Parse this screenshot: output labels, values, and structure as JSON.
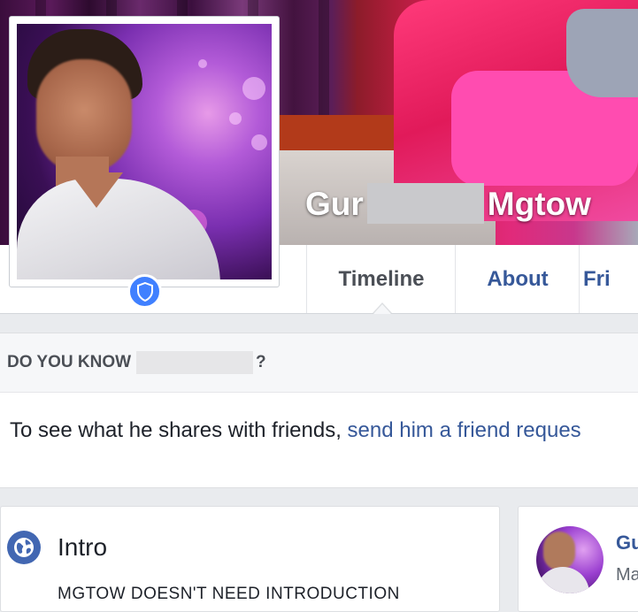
{
  "profile": {
    "name_first": "Gur",
    "name_last": "Mgtow"
  },
  "nav": {
    "tabs": [
      {
        "label": "Timeline",
        "active": true
      },
      {
        "label": "About",
        "active": false
      },
      {
        "label": "Fri",
        "active": false
      }
    ]
  },
  "know_card": {
    "heading": "DO YOU KNOW",
    "heading_suffix": "?",
    "text": "To see what he shares with friends,",
    "link": "send him a friend reques"
  },
  "intro": {
    "title": "Intro",
    "bio": "MGTOW DOESN'T NEED INTRODUCTION"
  },
  "right_card": {
    "name": "Gu",
    "subtitle": "Ma"
  },
  "colors": {
    "link": "#365899",
    "badge": "#4080ff",
    "globe": "#4267b2"
  },
  "icons": {
    "badge": "shield-icon",
    "intro": "globe-icon"
  }
}
